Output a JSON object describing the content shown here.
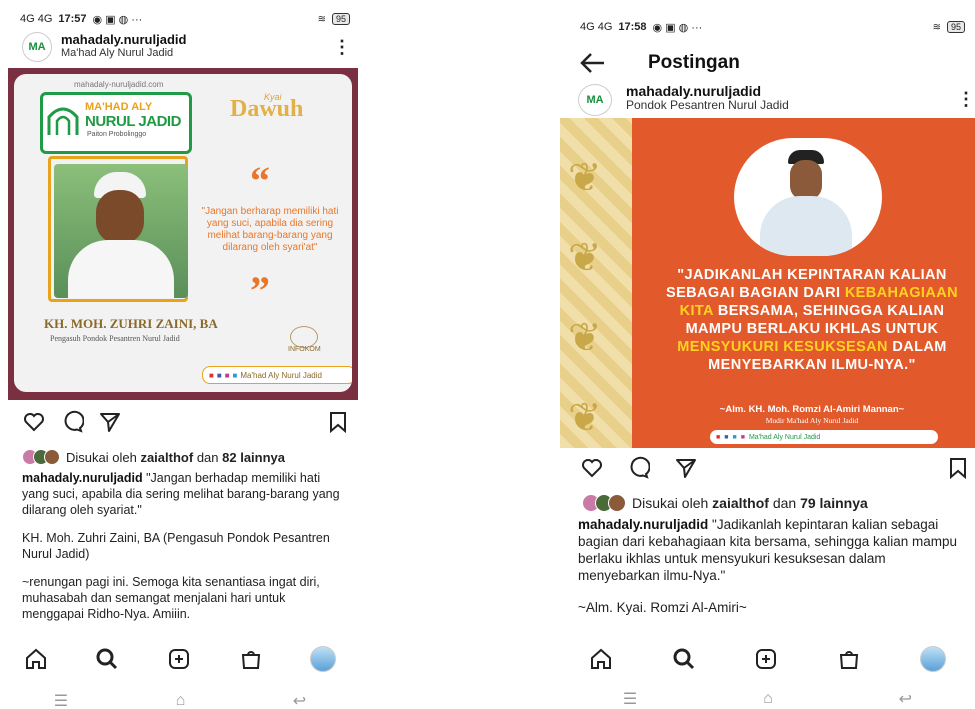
{
  "left": {
    "status": {
      "time": "17:57",
      "signal": "4G 4G",
      "battery": "95"
    },
    "header": {
      "username": "mahadaly.nuruljadid",
      "subtitle": "Ma'had Aly Nurul Jadid"
    },
    "image": {
      "site": "mahadaly-nuruljadid.com",
      "logo_line1": "MA'HAD ALY",
      "logo_line2": "NURUL JADID",
      "logo_sub": "Paiton Probolinggo",
      "rubric_small": "Kyai",
      "rubric": "Dawuh",
      "quote": "\"Jangan berharap memiliki hati yang suci, apabila dia sering melihat barang-barang yang dilarang oleh syari'at\"",
      "name": "KH. MOH. ZUHRI ZAINI, BA",
      "role": "Pengasuh Pondok Pesantren Nurul Jadid",
      "infokom": "INFOKOM",
      "social": "Ma'had Aly Nurul Jadid"
    },
    "likes": {
      "prefix": "Disukai oleh",
      "user": "zaialthof",
      "middle": "dan",
      "count": "82 lainnya"
    },
    "caption": {
      "username": "mahadaly.nuruljadid",
      "text1": "\"Jangan berhadap memiliki hati yang suci, apabila dia sering melihat barang-barang yang dilarang oleh syariat.\"",
      "text2": "KH. Moh. Zuhri Zaini, BA (Pengasuh Pondok Pesantren Nurul Jadid)",
      "text3": "~renungan pagi ini. Semoga kita senantiasa ingat diri, muhasabah dan semangat menjalani hari untuk menggapai Ridho-Nya. Amiiin."
    }
  },
  "right": {
    "status": {
      "time": "17:58",
      "signal": "4G 4G",
      "battery": "95"
    },
    "topbar": {
      "title": "Postingan"
    },
    "header": {
      "username": "mahadaly.nuruljadid",
      "subtitle": "Pondok Pesantren Nurul Jadid"
    },
    "image": {
      "quote_a": "\"JADIKANLAH KEPINTARAN KALIAN SEBAGAI BAGIAN DARI",
      "quote_hl1": "KEBAHAGIAAN KITA",
      "quote_b": "BERSAMA, SEHINGGA KALIAN MAMPU BERLAKU IKHLAS UNTUK",
      "quote_hl2": "MENSYUKURI KESUKSESAN",
      "quote_c": "DALAM MENYEBARKAN ILMU-NYA.\"",
      "author": "~Alm. KH. Moh. Romzi Al-Amiri Mannan~",
      "author_role": "Mudir Ma'had Aly Nurul Jadid",
      "footer_label": "Ma'had Aly Nurul Jadid"
    },
    "likes": {
      "prefix": "Disukai oleh",
      "user": "zaialthof",
      "middle": "dan",
      "count": "79 lainnya"
    },
    "caption": {
      "username": "mahadaly.nuruljadid",
      "text1": "\"Jadikanlah kepintaran kalian sebagai bagian dari kebahagiaan kita bersama, sehingga kalian mampu berlaku ikhlas untuk mensyukuri kesuksesan dalam menyebarkan ilmu-Nya.\"",
      "text2": "~Alm. Kyai. Romzi Al-Amiri~"
    }
  },
  "colors": {
    "brand_green": "#1f9a45",
    "accent_orange": "#e8772b",
    "post_red": "#e25a2c",
    "highlight_yellow": "#ffd21f"
  },
  "icons": [
    "heart-icon",
    "comment-icon",
    "share-icon",
    "bookmark-icon",
    "home-icon",
    "search-icon",
    "add-icon",
    "shop-icon",
    "profile-icon",
    "back-arrow-icon",
    "more-icon"
  ]
}
